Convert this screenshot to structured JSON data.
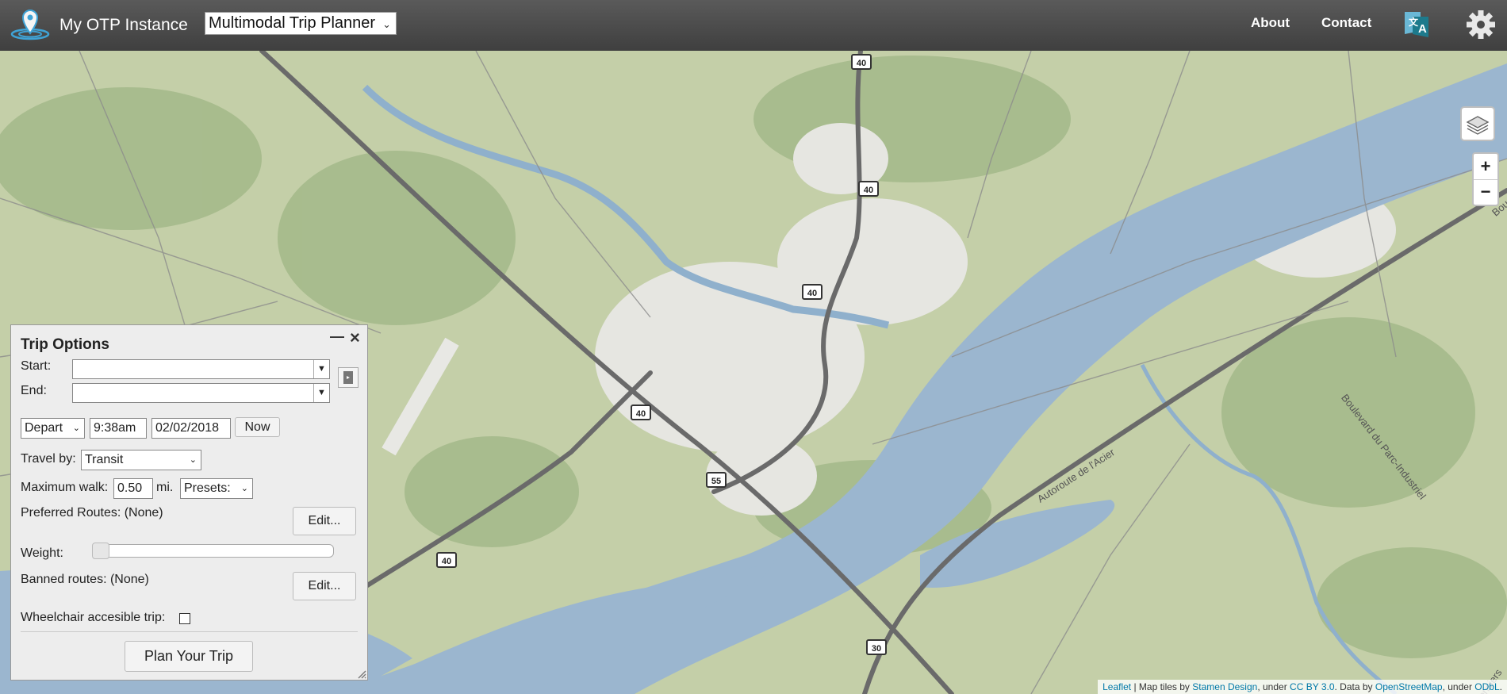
{
  "header": {
    "app_title": "My OTP Instance",
    "mode_selector": "Multimodal Trip Planner",
    "nav": [
      "About",
      "Contact"
    ]
  },
  "map": {
    "highway_shields": [
      "40",
      "40",
      "40",
      "40",
      "55",
      "40",
      "30"
    ],
    "road_labels": [
      "Boulevard du Parc-Industriel",
      "Autoroute de l'Acier",
      "Bou",
      "des Merisiers"
    ],
    "zoom_in": "+",
    "zoom_out": "−",
    "attribution": {
      "leaflet": "Leaflet",
      "sep1": " | Map tiles by ",
      "stamen": "Stamen Design",
      "sep2": ", under ",
      "cc": "CC BY 3.0",
      "sep3": ". Data by ",
      "osm": "OpenStreetMap",
      "sep4": ", under ",
      "odbl": "ODbL",
      "end": "."
    },
    "colors": {
      "water": "#9bb6cf",
      "land": "#c3cfa6",
      "urban": "#e9e9e5"
    }
  },
  "trip_options": {
    "title": "Trip Options",
    "minimize": "—",
    "close": "×",
    "start_label": "Start:",
    "start_value": "",
    "end_label": "End:",
    "end_value": "",
    "depart_mode": "Depart",
    "time": "9:38am",
    "date": "02/02/2018",
    "now_button": "Now",
    "travel_by_label": "Travel by:",
    "travel_by_value": "Transit",
    "max_walk_label": "Maximum walk:",
    "max_walk_value": "0.50",
    "max_walk_unit": "mi.",
    "presets": "Presets:",
    "preferred_routes_label": "Preferred Routes: (None)",
    "edit_label": "Edit...",
    "weight_label": "Weight:",
    "weight_value": 0,
    "banned_routes_label": "Banned routes: (None)",
    "wheelchair_label": "Wheelchair accesible trip:",
    "wheelchair_checked": false,
    "plan_button": "Plan Your Trip"
  }
}
